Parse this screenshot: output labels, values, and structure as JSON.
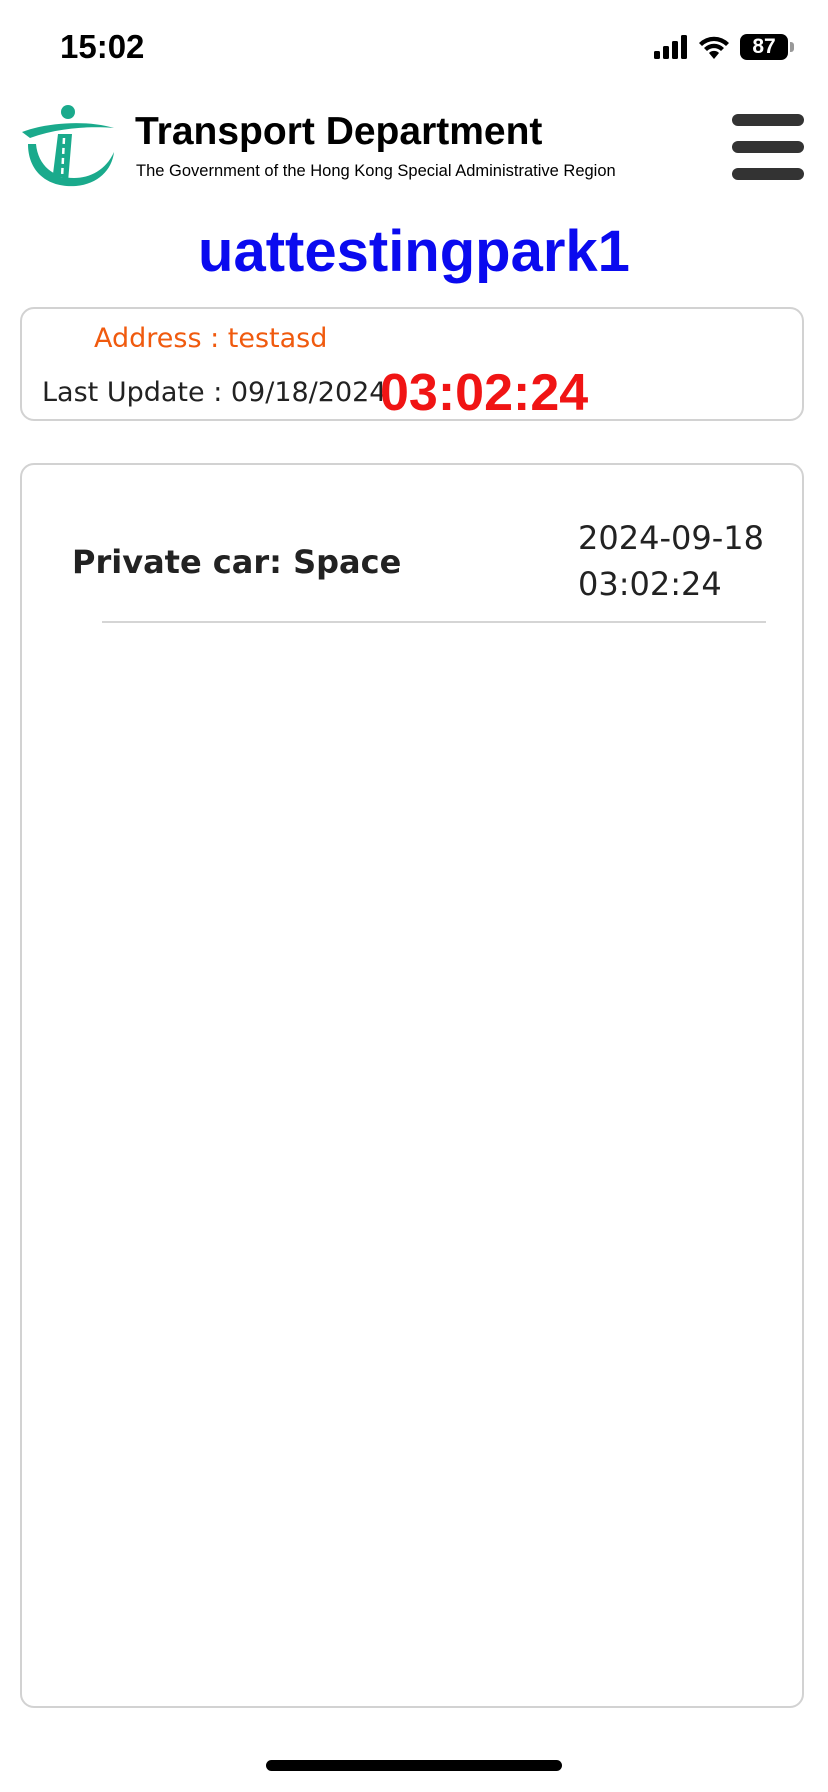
{
  "status_bar": {
    "time": "15:02",
    "battery": "87",
    "icons": [
      "cellular-signal-icon",
      "wifi-icon",
      "battery-icon"
    ]
  },
  "header": {
    "logo": "transport-department-logo-icon",
    "org_name": "Transport Department",
    "org_subtitle": "The Government of the Hong Kong Special Administrative Region",
    "menu_icon": "hamburger-menu-icon"
  },
  "park": {
    "name": "uattestingpark1",
    "address_text": "Address : testasd",
    "last_update_label": "Last Update : 09/18/2024",
    "last_update_time": "03:02:24"
  },
  "vacancies": [
    {
      "label": "Private car: Space",
      "date": "2024-09-18",
      "time": "03:02:24"
    }
  ],
  "colors": {
    "title": "#0a0aef",
    "address": "#f05a0e",
    "update_time": "#f01414",
    "logo": "#1aaa8c",
    "card_border": "#d2d2d2"
  }
}
